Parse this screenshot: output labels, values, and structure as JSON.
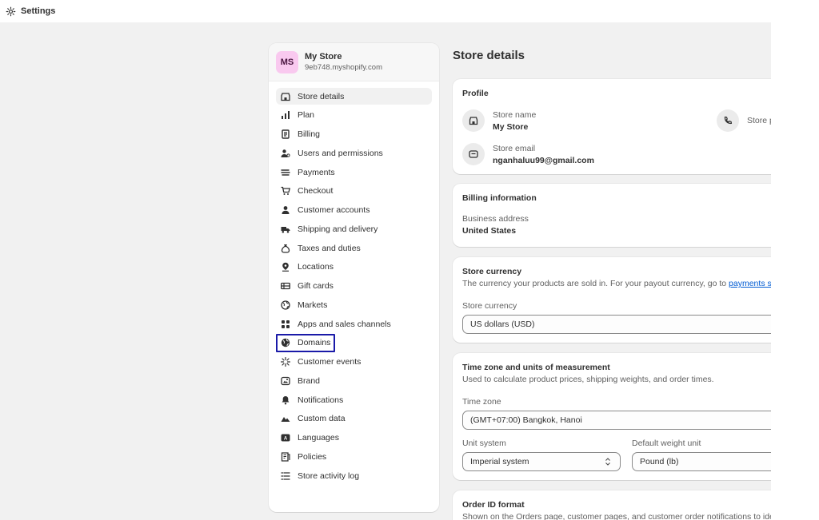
{
  "topbar": {
    "title": "Settings"
  },
  "store": {
    "initials": "MS",
    "name": "My Store",
    "domain": "9eb748.myshopify.com"
  },
  "nav": [
    {
      "label": "Store details",
      "icon": "store-icon"
    },
    {
      "label": "Plan",
      "icon": "plan-icon"
    },
    {
      "label": "Billing",
      "icon": "billing-icon"
    },
    {
      "label": "Users and permissions",
      "icon": "users-icon"
    },
    {
      "label": "Payments",
      "icon": "payments-icon"
    },
    {
      "label": "Checkout",
      "icon": "cart-icon"
    },
    {
      "label": "Customer accounts",
      "icon": "person-icon"
    },
    {
      "label": "Shipping and delivery",
      "icon": "truck-icon"
    },
    {
      "label": "Taxes and duties",
      "icon": "tax-bag-icon"
    },
    {
      "label": "Locations",
      "icon": "location-pin-icon"
    },
    {
      "label": "Gift cards",
      "icon": "gift-card-icon"
    },
    {
      "label": "Markets",
      "icon": "globe-icon"
    },
    {
      "label": "Apps and sales channels",
      "icon": "apps-grid-icon"
    },
    {
      "label": "Domains",
      "icon": "domain-globe-icon"
    },
    {
      "label": "Customer events",
      "icon": "sparkle-icon"
    },
    {
      "label": "Brand",
      "icon": "brand-icon"
    },
    {
      "label": "Notifications",
      "icon": "bell-icon"
    },
    {
      "label": "Custom data",
      "icon": "custom-data-icon"
    },
    {
      "label": "Languages",
      "icon": "language-icon"
    },
    {
      "label": "Policies",
      "icon": "policy-icon"
    },
    {
      "label": "Store activity log",
      "icon": "list-icon"
    }
  ],
  "main": {
    "title": "Store details",
    "profile": {
      "title": "Profile",
      "store_name_label": "Store name",
      "store_name_value": "My Store",
      "store_email_label": "Store email",
      "store_email_value": "nganhaluu99@gmail.com",
      "store_phone_label": "Store p"
    },
    "billing": {
      "title": "Billing information",
      "address_label": "Business address",
      "address_value": "United States"
    },
    "currency": {
      "title": "Store currency",
      "desc": "The currency your products are sold in. For your payout currency, go to ",
      "link": "payments set",
      "label": "Store currency",
      "value": "US dollars (USD)"
    },
    "timezone": {
      "title": "Time zone and units of measurement",
      "desc": "Used to calculate product prices, shipping weights, and order times.",
      "tz_label": "Time zone",
      "tz_value": "(GMT+07:00) Bangkok, Hanoi",
      "unit_label": "Unit system",
      "unit_value": "Imperial system",
      "weight_label": "Default weight unit",
      "weight_value": "Pound (lb)"
    },
    "order": {
      "title": "Order ID format",
      "desc": "Shown on the Orders page, customer pages, and customer order notifications to iden"
    }
  },
  "colors": {
    "focus_ring": "#1a1aa8",
    "avatar_bg": "#f9c9ef",
    "link": "#005bd3"
  }
}
